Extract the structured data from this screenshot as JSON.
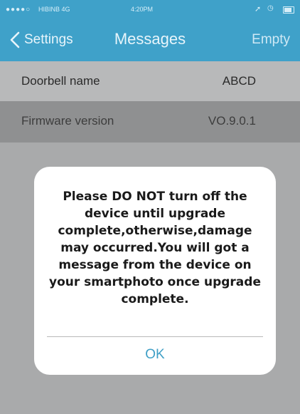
{
  "status_bar": {
    "signal": "●●●●○",
    "carrier": "HIBINB 4G",
    "time": "4:20PM"
  },
  "nav": {
    "back_label": "Settings",
    "title": "Messages",
    "right_label": "Empty"
  },
  "rows": [
    {
      "label": "Doorbell name",
      "value": "ABCD"
    },
    {
      "label": "Firmware version",
      "value": "VO.9.0.1"
    }
  ],
  "alert": {
    "message": "Please DO NOT turn off the device until upgrade complete,otherwise,damage may occurred.You will got a message from the device on your smartphoto once upgrade complete.",
    "ok_label": "OK"
  },
  "colors": {
    "nav_background": "#3fa1c9",
    "button_text": "#3f9fc6"
  }
}
